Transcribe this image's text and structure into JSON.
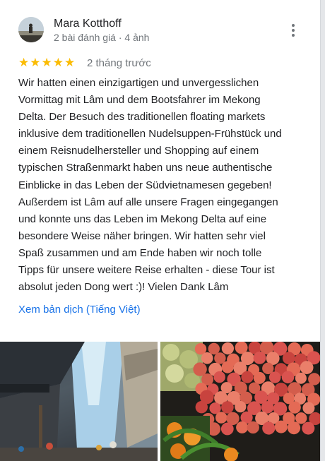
{
  "reviewer": {
    "name": "Mara Kotthoff",
    "meta": "2 bài đánh giá · 4 ảnh"
  },
  "review": {
    "rating": 5,
    "star_glyph": "★",
    "date": "2 tháng trước",
    "text_lines": [
      "Wir hatten einen einzigartigen und unvergesslichen",
      "Vormittag mit Lâm und dem Bootsfahrer im Mekong",
      "Delta. Der Besuch des traditionellen floating markets",
      "inklusive dem traditionellen Nudelsuppen-Frühstück und",
      "einem Reisnudelhersteller und Shopping auf einem",
      "typischen Straßenmarkt haben uns neue authentische",
      "Einblicke in das Leben der Südvietnamesen gegeben!",
      "Außerdem ist Lâm auf alle unsere Fragen eingegangen",
      "und konnte uns das Leben im Mekong Delta auf eine",
      "besondere Weise näher bringen. Wir hatten sehr viel",
      "Spaß zusammen und am Ende haben wir noch tolle",
      "Tipps für unsere weitere Reise erhalten - diese Tour ist",
      "absolut jeden Dong wert :)! Vielen Dank Lâm"
    ],
    "translate_label": "Xem bản dịch (Tiếng Việt)"
  },
  "icons": {
    "more": "more-vert-icon",
    "star": "star-icon"
  },
  "colors": {
    "star": "#fbbc04",
    "link": "#1a73e8",
    "text": "#202124",
    "secondary": "#70757a"
  }
}
